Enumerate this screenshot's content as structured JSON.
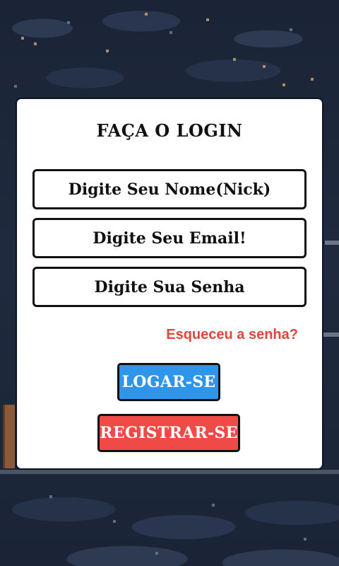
{
  "login": {
    "title": "FAÇA O LOGIN",
    "name_placeholder": "Digite Seu Nome(Nick)",
    "email_placeholder": "Digite Seu Email!",
    "password_placeholder": "Digite Sua Senha",
    "forgot_password": "Esqueceu a senha?",
    "login_button": "LOGAR-SE",
    "register_button": "REGISTRAR-SE"
  },
  "colors": {
    "login_button": "#2f95eb",
    "register_button": "#f04a46",
    "forgot_link": "#e2453c",
    "card": "#ffffff",
    "background": "#1b2638"
  }
}
